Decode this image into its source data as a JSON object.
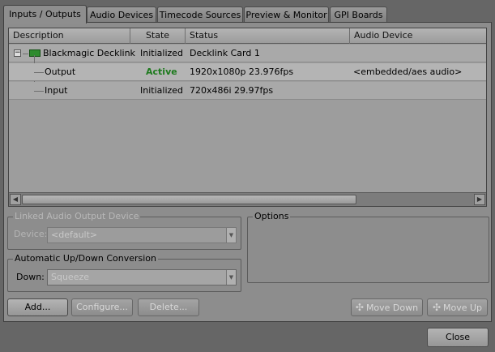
{
  "tabs": [
    {
      "label": "Inputs / Outputs",
      "active": true
    },
    {
      "label": "Audio Devices",
      "active": false
    },
    {
      "label": "Timecode Sources",
      "active": false
    },
    {
      "label": "Preview & Monitor",
      "active": false
    },
    {
      "label": "GPI Boards",
      "active": false
    }
  ],
  "table": {
    "columns": [
      "Description",
      "State",
      "Status",
      "Audio Device"
    ],
    "rows": [
      {
        "description": "Blackmagic Decklink",
        "state": "Initialized",
        "status": "Decklink Card 1",
        "audio_device": "",
        "level": 0,
        "expander": "−"
      },
      {
        "description": "Output",
        "state": "Active",
        "status": "1920x1080p 23.976fps",
        "audio_device": "<embedded/aes audio>",
        "level": 1
      },
      {
        "description": "Input",
        "state": "Initialized",
        "status": "720x486i 29.97fps",
        "audio_device": "",
        "level": 1
      }
    ],
    "scroll_left_arrow": "◀",
    "scroll_right_arrow": "▶"
  },
  "linked_audio": {
    "legend": "Linked Audio Output Device",
    "device_label": "Device:",
    "device_value": "<default>"
  },
  "conversion": {
    "legend": "Automatic Up/Down Conversion",
    "down_label": "Down:",
    "down_value": "Squeeze"
  },
  "options": {
    "legend": "Options"
  },
  "buttons": {
    "add": "Add...",
    "configure": "Configure...",
    "delete": "Delete...",
    "move_down": "Move Down",
    "move_up": "Move Up",
    "close": "Close"
  },
  "icons": {
    "combo_arrow": "▼",
    "move_down_icon": "✣",
    "move_up_icon": "✣"
  },
  "colors": {
    "active_state": "#1d7a1d",
    "background": "#666666",
    "panel": "#8d8d8d"
  }
}
